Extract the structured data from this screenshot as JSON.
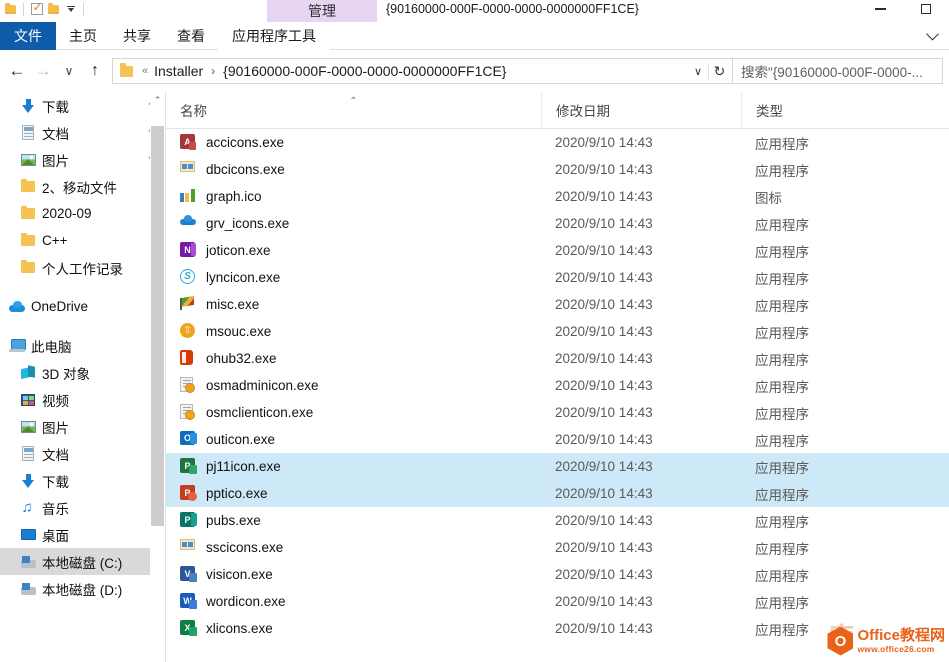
{
  "window": {
    "title": "{90160000-000F-0000-0000-0000000FF1CE}",
    "minimize_label": "—",
    "maximize_label": "□",
    "quick_access": [
      {
        "name": "folder-icon",
        "label": ""
      },
      {
        "name": "properties-checkbox-icon",
        "label": ""
      },
      {
        "name": "new-folder-icon",
        "label": ""
      },
      {
        "name": "customize-quick-access-icon",
        "label": ""
      }
    ]
  },
  "ribbon": {
    "context_banner": "管理",
    "tabs": [
      {
        "label": "文件",
        "active": true,
        "kind": "file"
      },
      {
        "label": "主页",
        "active": false,
        "kind": "normal"
      },
      {
        "label": "共享",
        "active": false,
        "kind": "normal"
      },
      {
        "label": "查看",
        "active": false,
        "kind": "normal"
      },
      {
        "label": "应用程序工具",
        "active": true,
        "kind": "context"
      }
    ]
  },
  "nav": {
    "back_icon": "←",
    "forward_icon": "→",
    "recent_icon": "∨",
    "up_icon": "↑",
    "breadcrumb_overflow": "«",
    "breadcrumb": [
      "Installer",
      "{90160000-000F-0000-0000-0000000FF1CE}"
    ],
    "breadcrumb_separator": "›",
    "address_dropdown_icon": "∨",
    "refresh_icon": "↻"
  },
  "search": {
    "placeholder": "搜索\"{90160000-000F-0000-..."
  },
  "sidebar": {
    "scroll_up_icon": "⌃",
    "items": [
      {
        "label": "下载",
        "icon": "download-icon",
        "indent": 1,
        "pinned": true,
        "selected": false
      },
      {
        "label": "文档",
        "icon": "documents-icon",
        "indent": 1,
        "pinned": true,
        "selected": false
      },
      {
        "label": "图片",
        "icon": "pictures-icon",
        "indent": 1,
        "pinned": true,
        "selected": false
      },
      {
        "label": "2、移动文件",
        "icon": "folder-icon",
        "indent": 1,
        "pinned": false,
        "selected": false
      },
      {
        "label": "2020-09",
        "icon": "folder-icon",
        "indent": 1,
        "pinned": false,
        "selected": false
      },
      {
        "label": "C++",
        "icon": "folder-icon",
        "indent": 1,
        "pinned": false,
        "selected": false
      },
      {
        "label": "个人工作记录",
        "icon": "folder-icon",
        "indent": 1,
        "pinned": false,
        "selected": false
      },
      {
        "label": "",
        "icon": "spacer",
        "indent": 0,
        "pinned": false,
        "selected": false
      },
      {
        "label": "OneDrive",
        "icon": "onedrive-icon",
        "indent": 0,
        "pinned": false,
        "selected": false
      },
      {
        "label": "",
        "icon": "spacer",
        "indent": 0,
        "pinned": false,
        "selected": false
      },
      {
        "label": "此电脑",
        "icon": "this-pc-icon",
        "indent": 0,
        "pinned": false,
        "selected": false
      },
      {
        "label": "3D 对象",
        "icon": "3d-objects-icon",
        "indent": 1,
        "pinned": false,
        "selected": false
      },
      {
        "label": "视频",
        "icon": "videos-icon",
        "indent": 1,
        "pinned": false,
        "selected": false
      },
      {
        "label": "图片",
        "icon": "pictures-icon",
        "indent": 1,
        "pinned": false,
        "selected": false
      },
      {
        "label": "文档",
        "icon": "documents-icon",
        "indent": 1,
        "pinned": false,
        "selected": false
      },
      {
        "label": "下载",
        "icon": "download-icon",
        "indent": 1,
        "pinned": false,
        "selected": false
      },
      {
        "label": "音乐",
        "icon": "music-icon",
        "indent": 1,
        "pinned": false,
        "selected": false
      },
      {
        "label": "桌面",
        "icon": "desktop-icon",
        "indent": 1,
        "pinned": false,
        "selected": false
      },
      {
        "label": "本地磁盘 (C:)",
        "icon": "local-disk-icon",
        "indent": 1,
        "pinned": false,
        "selected": true
      },
      {
        "label": "本地磁盘 (D:)",
        "icon": "local-disk-icon",
        "indent": 1,
        "pinned": false,
        "selected": false
      }
    ]
  },
  "filelist": {
    "columns": [
      {
        "label": "名称",
        "key": "name",
        "sorted": "asc",
        "sort_icon": "⌃"
      },
      {
        "label": "修改日期",
        "key": "date",
        "sorted": "",
        "sort_icon": ""
      },
      {
        "label": "类型",
        "key": "type",
        "sorted": "",
        "sort_icon": ""
      }
    ],
    "rows": [
      {
        "name": "accicons.exe",
        "date": "2020/9/10 14:43",
        "type": "应用程序",
        "icon": "access-icon",
        "selected": false
      },
      {
        "name": "dbcicons.exe",
        "date": "2020/9/10 14:43",
        "type": "应用程序",
        "icon": "dbcicons-icon",
        "selected": false
      },
      {
        "name": "graph.ico",
        "date": "2020/9/10 14:43",
        "type": "图标",
        "icon": "graph-chart-icon",
        "selected": false
      },
      {
        "name": "grv_icons.exe",
        "date": "2020/9/10 14:43",
        "type": "应用程序",
        "icon": "groove-cloud-icon",
        "selected": false
      },
      {
        "name": "joticon.exe",
        "date": "2020/9/10 14:43",
        "type": "应用程序",
        "icon": "onenote-icon",
        "selected": false
      },
      {
        "name": "lyncicon.exe",
        "date": "2020/9/10 14:43",
        "type": "应用程序",
        "icon": "skype-lync-icon",
        "selected": false
      },
      {
        "name": "misc.exe",
        "date": "2020/9/10 14:43",
        "type": "应用程序",
        "icon": "misc-flag-icon",
        "selected": false
      },
      {
        "name": "msouc.exe",
        "date": "2020/9/10 14:43",
        "type": "应用程序",
        "icon": "upload-center-icon",
        "selected": false
      },
      {
        "name": "ohub32.exe",
        "date": "2020/9/10 14:43",
        "type": "应用程序",
        "icon": "office-hub-icon",
        "selected": false
      },
      {
        "name": "osmadminicon.exe",
        "date": "2020/9/10 14:43",
        "type": "应用程序",
        "icon": "osm-admin-icon",
        "selected": false
      },
      {
        "name": "osmclienticon.exe",
        "date": "2020/9/10 14:43",
        "type": "应用程序",
        "icon": "osm-client-icon",
        "selected": false
      },
      {
        "name": "outicon.exe",
        "date": "2020/9/10 14:43",
        "type": "应用程序",
        "icon": "outlook-icon",
        "selected": false
      },
      {
        "name": "pj11icon.exe",
        "date": "2020/9/10 14:43",
        "type": "应用程序",
        "icon": "project-icon",
        "selected": true
      },
      {
        "name": "pptico.exe",
        "date": "2020/9/10 14:43",
        "type": "应用程序",
        "icon": "powerpoint-icon",
        "selected": true
      },
      {
        "name": "pubs.exe",
        "date": "2020/9/10 14:43",
        "type": "应用程序",
        "icon": "publisher-icon",
        "selected": false
      },
      {
        "name": "sscicons.exe",
        "date": "2020/9/10 14:43",
        "type": "应用程序",
        "icon": "dbcicons-icon",
        "selected": false
      },
      {
        "name": "visicon.exe",
        "date": "2020/9/10 14:43",
        "type": "应用程序",
        "icon": "visio-icon",
        "selected": false
      },
      {
        "name": "wordicon.exe",
        "date": "2020/9/10 14:43",
        "type": "应用程序",
        "icon": "word-icon",
        "selected": false
      },
      {
        "name": "xlicons.exe",
        "date": "2020/9/10 14:43",
        "type": "应用程序",
        "icon": "excel-icon",
        "selected": false
      }
    ]
  },
  "watermark": {
    "hex_letter": "O",
    "line1": "Office教程网",
    "line2": "www.office26.com",
    "ghost_char": "库",
    "color": "#e8621a"
  },
  "colors": {
    "file_tab": "#0f5cab",
    "context_banner": "#e6d6f2",
    "selection": "#cde8f7",
    "sidebar_selection": "#d9d9d9"
  }
}
